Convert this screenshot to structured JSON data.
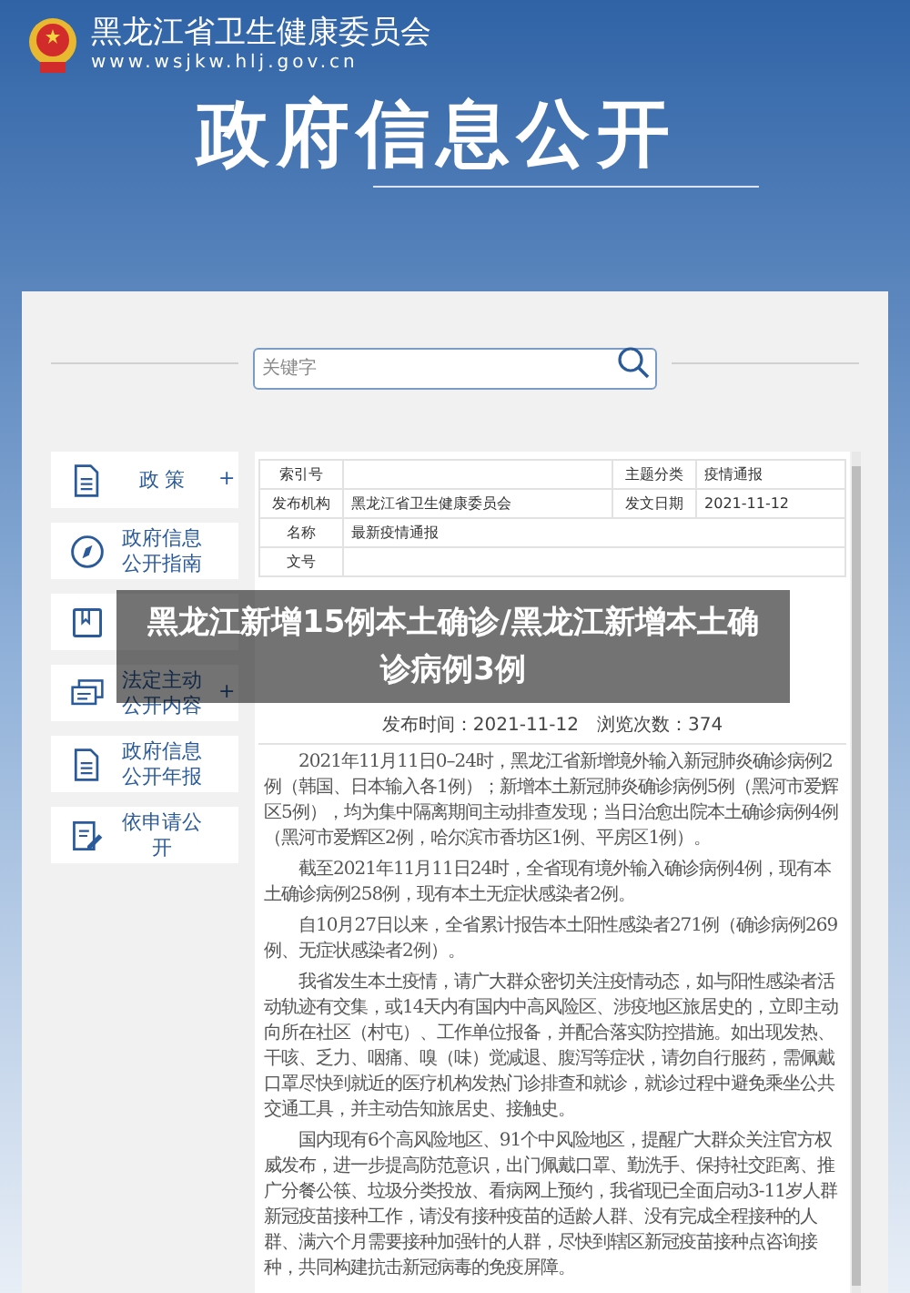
{
  "header": {
    "org_name": "黑龙江省卫生健康委员会",
    "url": "www.wsjkw.hlj.gov.cn",
    "section_title": "政府信息公开"
  },
  "search": {
    "placeholder": "关键字"
  },
  "sidebar": {
    "items": [
      {
        "label": "政 策",
        "kind": "policy",
        "toggle": "+"
      },
      {
        "label": "政府信息公开指南",
        "kind": "guide"
      },
      {
        "kind": "rules"
      },
      {
        "label": "法定主动公开内容",
        "kind": "content",
        "toggle": "+"
      },
      {
        "label": "政府信息公开年报",
        "kind": "report"
      },
      {
        "label": "依申请公开",
        "kind": "apply"
      }
    ]
  },
  "info_table": {
    "rows": [
      [
        {
          "label": "索引号"
        },
        {
          "label": "主题分类",
          "value": "疫情通报"
        }
      ],
      [
        {
          "label": "发布机构",
          "value": "黑龙江省卫生健康委员会"
        },
        {
          "label": "发文日期",
          "value": "2021-11-12"
        }
      ],
      [
        {
          "label": "名称",
          "value": "最新疫情通报"
        }
      ],
      [
        {
          "label": "文号"
        }
      ]
    ]
  },
  "article": {
    "publish_time": "发布时间：2021-11-12",
    "views": "浏览次数：374",
    "paragraphs": [
      "2021年11月11日0–24时，黑龙江省新增境外输入新冠肺炎确诊病例2例（韩国、日本输入各1例）；新增本土新冠肺炎确诊病例5例（黑河市爱辉区5例），均为集中隔离期间主动排查发现；当日治愈出院本土确诊病例4例（黑河市爱辉区2例，哈尔滨市香坊区1例、平房区1例）。",
      "截至2021年11月11日24时，全省现有境外输入确诊病例4例，现有本土确诊病例258例，现有本土无症状感染者2例。",
      "自10月27日以来，全省累计报告本土阳性感染者271例（确诊病例269例、无症状感染者2例）。",
      "我省发生本土疫情，请广大群众密切关注疫情动态，如与阳性感染者活动轨迹有交集，或14天内有国内中高风险区、涉疫地区旅居史的，立即主动向所在社区（村屯）、工作单位报备，并配合落实防控措施。如出现发热、干咳、乏力、咽痛、嗅（味）觉减退、腹泻等症状，请勿自行服药，需佩戴口罩尽快到就近的医疗机构发热门诊排查和就诊，就诊过程中避免乘坐公共交通工具，并主动告知旅居史、接触史。",
      "国内现有6个高风险地区、91个中风险地区，提醒广大群众关注官方权威发布，进一步提高防范意识，出门佩戴口罩、勤洗手、保持社交距离、推广分餐公筷、垃圾分类投放、看病网上预约，我省现已全面启动3-11岁人群新冠疫苗接种工作，请没有接种疫苗的适龄人群、没有完成全程接种的人群、满六个月需要接种加强针的人群，尽快到辖区新冠疫苗接种点咨询接种，共同构建抗击新冠病毒的免疫屏障。"
    ]
  },
  "overlay_headline": "黑龙江新增15例本土确诊/黑龙江新增本土确诊病例3例"
}
